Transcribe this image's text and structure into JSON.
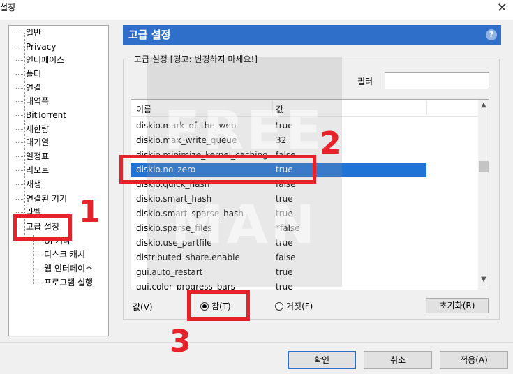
{
  "window": {
    "title": "설정",
    "close_symbol": "✕"
  },
  "sidebar": {
    "items": [
      {
        "label": "일반"
      },
      {
        "label": "Privacy"
      },
      {
        "label": "인터페이스"
      },
      {
        "label": "폴더"
      },
      {
        "label": "연결"
      },
      {
        "label": "대역폭"
      },
      {
        "label": "BitTorrent"
      },
      {
        "label": "제한량"
      },
      {
        "label": "대기열"
      },
      {
        "label": "일정표"
      },
      {
        "label": "리모트"
      },
      {
        "label": "재생"
      },
      {
        "label": "연결된 기기"
      },
      {
        "label": "라벨"
      },
      {
        "label": "고급 설정"
      },
      {
        "label": "UI 기타"
      },
      {
        "label": "디스크 캐시"
      },
      {
        "label": "웹 인터페이스"
      },
      {
        "label": "프로그램 실행"
      }
    ]
  },
  "main": {
    "header_title": "고급 설정",
    "help_symbol": "?",
    "group_title": "고급 설정 [경고: 변경하지 마세요!]",
    "filter_label": "필터",
    "filter_value": "",
    "columns": {
      "name": "이름",
      "value": "값"
    },
    "rows": [
      {
        "key": "diskio.mark_of_the_web",
        "value": "true"
      },
      {
        "key": "diskio.max_write_queue",
        "value": "32"
      },
      {
        "key": "diskio.minimize_kernel_caching",
        "value": "false"
      },
      {
        "key": "diskio.no_zero",
        "value": "true"
      },
      {
        "key": "diskio.quick_hash",
        "value": "false"
      },
      {
        "key": "diskio.smart_hash",
        "value": "true"
      },
      {
        "key": "diskio.smart_sparse_hash",
        "value": "true"
      },
      {
        "key": "diskio.sparse_files",
        "value": "*false"
      },
      {
        "key": "diskio.use_partfile",
        "value": "true"
      },
      {
        "key": "distributed_share.enable",
        "value": "false"
      },
      {
        "key": "gui.auto_restart",
        "value": "true"
      },
      {
        "key": "gui.color_progress_bars",
        "value": "true"
      }
    ],
    "selected_row": 3,
    "value_label": "값(V)",
    "radio_true_label": "참(T)",
    "radio_false_label": "거짓(F)",
    "radio_selected": "true",
    "reset_label": "초기화(R)"
  },
  "footer": {
    "ok_label": "확인",
    "cancel_label": "취소",
    "apply_label": "적용(A)"
  },
  "annotations": {
    "one": "1",
    "two": "2",
    "three": "3"
  },
  "watermark": {
    "line1": "FREE",
    "line2": "MAN"
  },
  "colors": {
    "header_blue": "#2f6fc9",
    "selection_blue": "#1f74d6",
    "annotation_red": "#e8222a"
  }
}
